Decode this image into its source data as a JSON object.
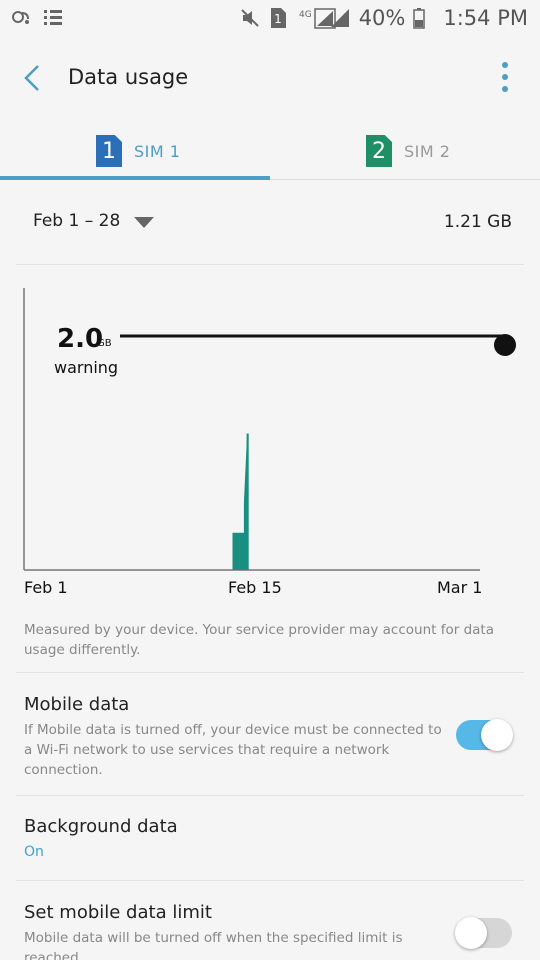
{
  "status_bar": {
    "battery_percent": "40%",
    "time": "1:54 PM",
    "network_label": "4G",
    "sim_indicator": "1",
    "left_icons": [
      "app-icon",
      "list-icon"
    ],
    "right_icons": [
      "mute-icon",
      "sim-icon",
      "signal-icon",
      "battery-icon"
    ]
  },
  "app_bar": {
    "title": "Data usage",
    "back_icon": "back-arrow-icon",
    "menu_icon": "more-vert-icon"
  },
  "tabs": [
    {
      "badge": "1",
      "label": "SIM 1",
      "selected": true,
      "badge_color": "#2a6fb7",
      "label_color": "#4a9ec7"
    },
    {
      "badge": "2",
      "label": "SIM 2",
      "selected": false,
      "badge_color": "#1f8f67",
      "label_color": "#9a9a9a"
    }
  ],
  "period": {
    "range": "Feb 1 – 28",
    "total": "1.21 GB"
  },
  "chart": {
    "warning_value": "2.0",
    "warning_unit": "GB",
    "warning_label": "warning",
    "x_labels": [
      "Feb 1",
      "Feb 15",
      "Mar 1"
    ]
  },
  "chart_data": {
    "type": "area",
    "x_start": "Feb 1",
    "x_end": "Mar 1",
    "y_unit": "GB",
    "warning_gb": 2.0,
    "ylim": [
      0,
      2.5
    ],
    "series": [
      {
        "color": "#1a8f80",
        "points": [
          {
            "day": 13.8,
            "gb": 0
          },
          {
            "day": 13.8,
            "gb": 0.33
          },
          {
            "day": 14.5,
            "gb": 0.33
          },
          {
            "day": 14.5,
            "gb": 0.6
          },
          {
            "day": 14.7,
            "gb": 1.21
          },
          {
            "day": 14.8,
            "gb": 1.21
          },
          {
            "day": 14.8,
            "gb": 0
          }
        ]
      }
    ],
    "x_ticks": [
      "Feb 1",
      "Feb 15",
      "Mar 1"
    ]
  },
  "note": "Measured by your device. Your service provider may account for data usage differently.",
  "settings": {
    "mobile_data": {
      "title": "Mobile data",
      "description": "If Mobile data is turned off, your device must be connected to a Wi-Fi network to use services that require a network connection.",
      "enabled": true
    },
    "background_data": {
      "title": "Background data",
      "value": "On"
    },
    "mobile_data_limit": {
      "title": "Set mobile data limit",
      "description": "Mobile data will be turned off when the specified limit is reached.",
      "enabled": false
    }
  },
  "colors": {
    "accent": "#4a9ec7",
    "toggle_on": "#56b8e6",
    "chart_fill": "#1a8f80"
  }
}
